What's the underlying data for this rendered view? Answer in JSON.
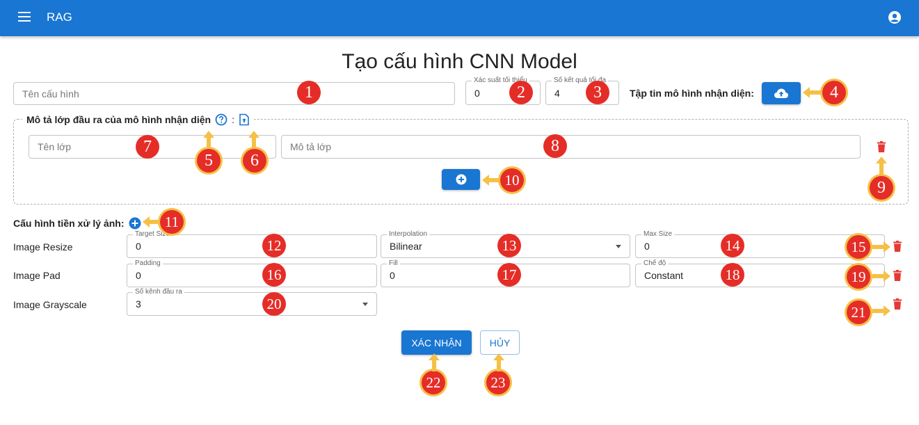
{
  "appbar": {
    "title": "RAG"
  },
  "page": {
    "title": "Tạo cấu hình CNN Model"
  },
  "config": {
    "name_placeholder": "Tên cấu hình",
    "threshold_label": "Xác suất tối thiểu",
    "threshold_value": "0",
    "results_label": "Số kết quả tối đa",
    "results_value": "4",
    "model_file_label": "Tập tin mô hình nhận diện:"
  },
  "output_classes": {
    "legend": "Mô tả lớp đầu ra của mô hình nhận diện",
    "separator": ":",
    "class_name_placeholder": "Tên lớp",
    "class_desc_placeholder": "Mô tả lớp"
  },
  "preprocess": {
    "title": "Cấu hình tiền xử lý ảnh:",
    "resize": {
      "label": "Image Resize",
      "target_size_label": "Target Size",
      "target_size_value": "0",
      "interpolation_label": "Interpolation",
      "interpolation_value": "Bilinear",
      "max_size_label": "Max Size",
      "max_size_value": "0"
    },
    "pad": {
      "label": "Image Pad",
      "padding_label": "Padding",
      "padding_value": "0",
      "fill_label": "Fill",
      "fill_value": "0",
      "mode_label": "Chế độ",
      "mode_value": "Constant"
    },
    "grayscale": {
      "label": "Image Grayscale",
      "channels_label": "Số kênh đầu ra",
      "channels_value": "3"
    }
  },
  "actions": {
    "confirm": "XÁC NHẬN",
    "cancel": "HỦY"
  },
  "annotations": [
    "1",
    "2",
    "3",
    "4",
    "5",
    "6",
    "7",
    "8",
    "9",
    "10",
    "11",
    "12",
    "13",
    "14",
    "15",
    "16",
    "17",
    "18",
    "19",
    "20",
    "21",
    "22",
    "23"
  ],
  "colors": {
    "primary": "#1976d2",
    "danger": "#e53935",
    "marker": "#e52d27",
    "marker_ring": "#f5c046"
  }
}
